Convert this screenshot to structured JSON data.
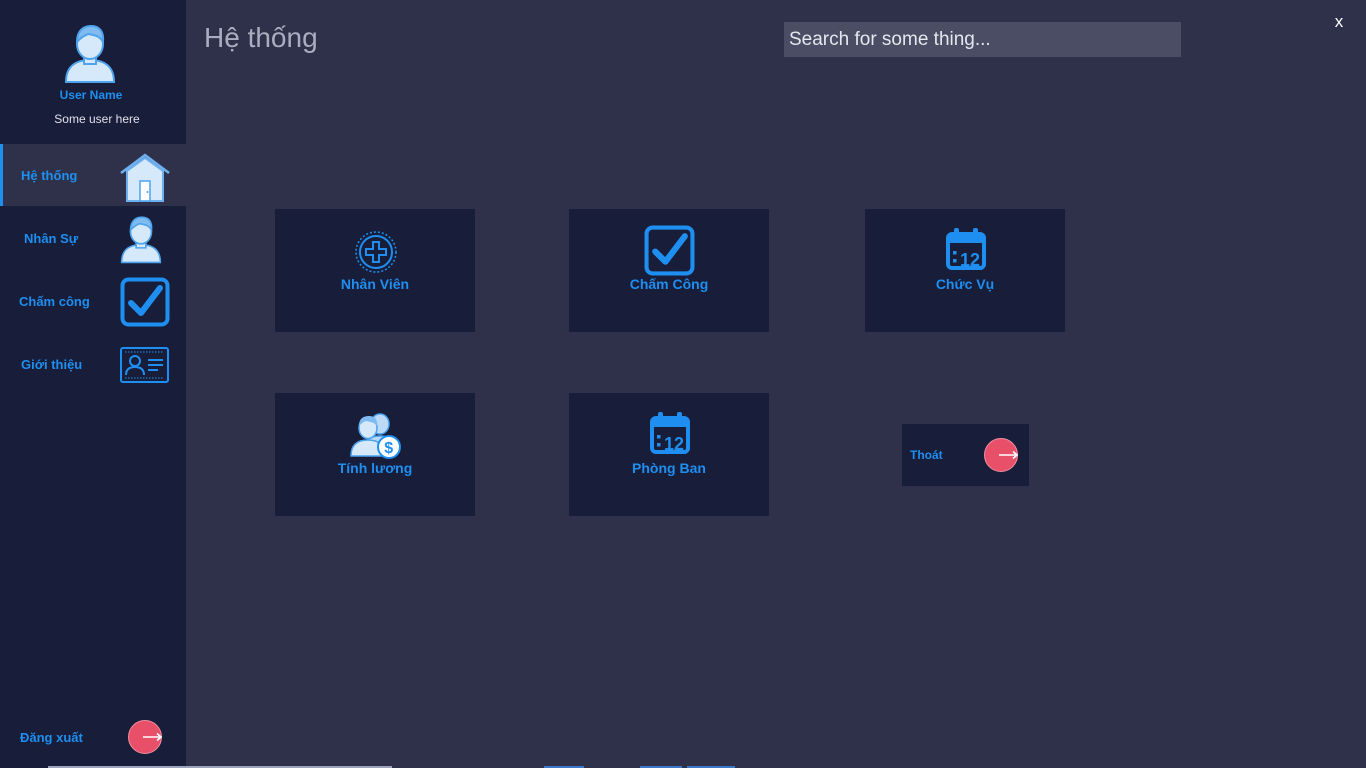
{
  "profile": {
    "name": "User Name",
    "subtitle": "Some user here"
  },
  "nav": {
    "items": [
      {
        "label": "Hệ thống",
        "icon": "house-icon",
        "active": true
      },
      {
        "label": "Nhân Sự",
        "icon": "person-icon",
        "active": false
      },
      {
        "label": "Chấm công",
        "icon": "checkbox-icon",
        "active": false
      },
      {
        "label": "Giới thiệu",
        "icon": "id-card-icon",
        "active": false
      }
    ],
    "logout_label": "Đăng xuất"
  },
  "header": {
    "title": "Hệ thống",
    "search_placeholder": "Search for some thing...",
    "close_label": "x"
  },
  "tiles": [
    {
      "label": "Nhân Viên",
      "icon": "plus-circle-icon"
    },
    {
      "label": "Chấm Công",
      "icon": "checkbox-icon"
    },
    {
      "label": "Chức Vụ",
      "icon": "calendar-icon"
    },
    {
      "label": "Tính lương",
      "icon": "people-dollar-icon"
    },
    {
      "label": "Phòng Ban",
      "icon": "calendar-icon"
    }
  ],
  "exit_button": {
    "label": "Thoát",
    "icon": "exit-icon"
  },
  "colors": {
    "accent": "#1e8ff0",
    "sidebar": "#181d3a",
    "background": "#2e3149",
    "exit": "#e8506a"
  }
}
